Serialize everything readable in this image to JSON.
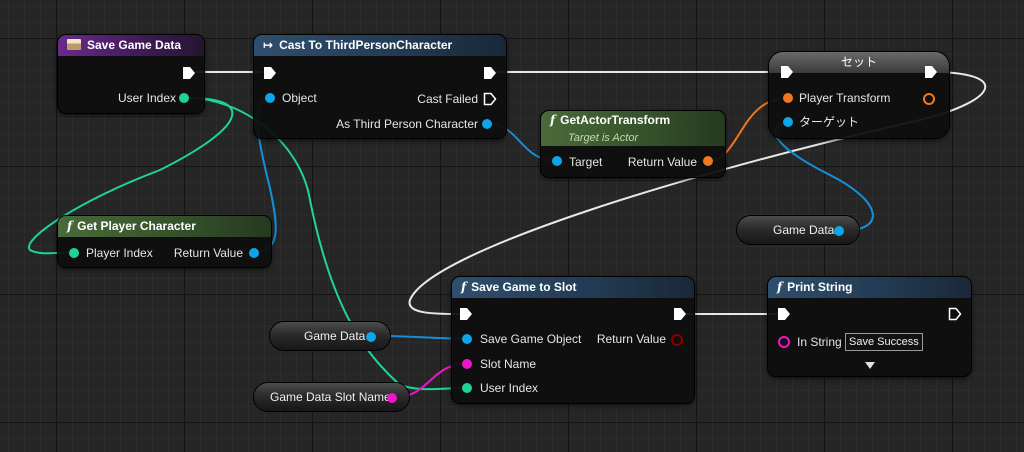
{
  "nodes": {
    "save_game_data": {
      "title": "Save Game Data",
      "pins": {
        "user_index": "User Index"
      }
    },
    "cast_to_character": {
      "title": "Cast To ThirdPersonCharacter",
      "pins": {
        "object": "Object",
        "cast_failed": "Cast Failed",
        "as_character": "As Third Person Character"
      }
    },
    "get_actor_transform": {
      "title": "GetActorTransform",
      "subtitle": "Target is Actor",
      "pins": {
        "target": "Target",
        "return_value": "Return Value"
      }
    },
    "set_node": {
      "title": "セット",
      "pins": {
        "player_transform": "Player Transform",
        "target": "ターゲット"
      }
    },
    "get_player_character": {
      "title": "Get Player Character",
      "pins": {
        "player_index": "Player Index",
        "return_value": "Return Value"
      }
    },
    "game_data_var_right": {
      "label": "Game Data"
    },
    "save_game_to_slot": {
      "title": "Save Game to Slot",
      "pins": {
        "save_game_object": "Save Game Object",
        "return_value": "Return Value",
        "slot_name": "Slot Name",
        "user_index": "User Index"
      }
    },
    "print_string": {
      "title": "Print String",
      "pins": {
        "in_string": "In String",
        "in_string_value": "Save Success"
      }
    },
    "game_data_var_left": {
      "label": "Game Data"
    },
    "slot_name_var": {
      "label": "Game Data Slot Name"
    }
  },
  "icons": {
    "function": "f",
    "event": "event-box-icon",
    "cast": "cast-arrow-icon",
    "expand": "expand-arrow-icon"
  },
  "colors": {
    "exec": "#ffffff",
    "object": "#0ea5e9",
    "integer": "#1fd49a",
    "string": "#f015c8",
    "struct_transform": "#f07820",
    "boolean": "#8a0000"
  }
}
